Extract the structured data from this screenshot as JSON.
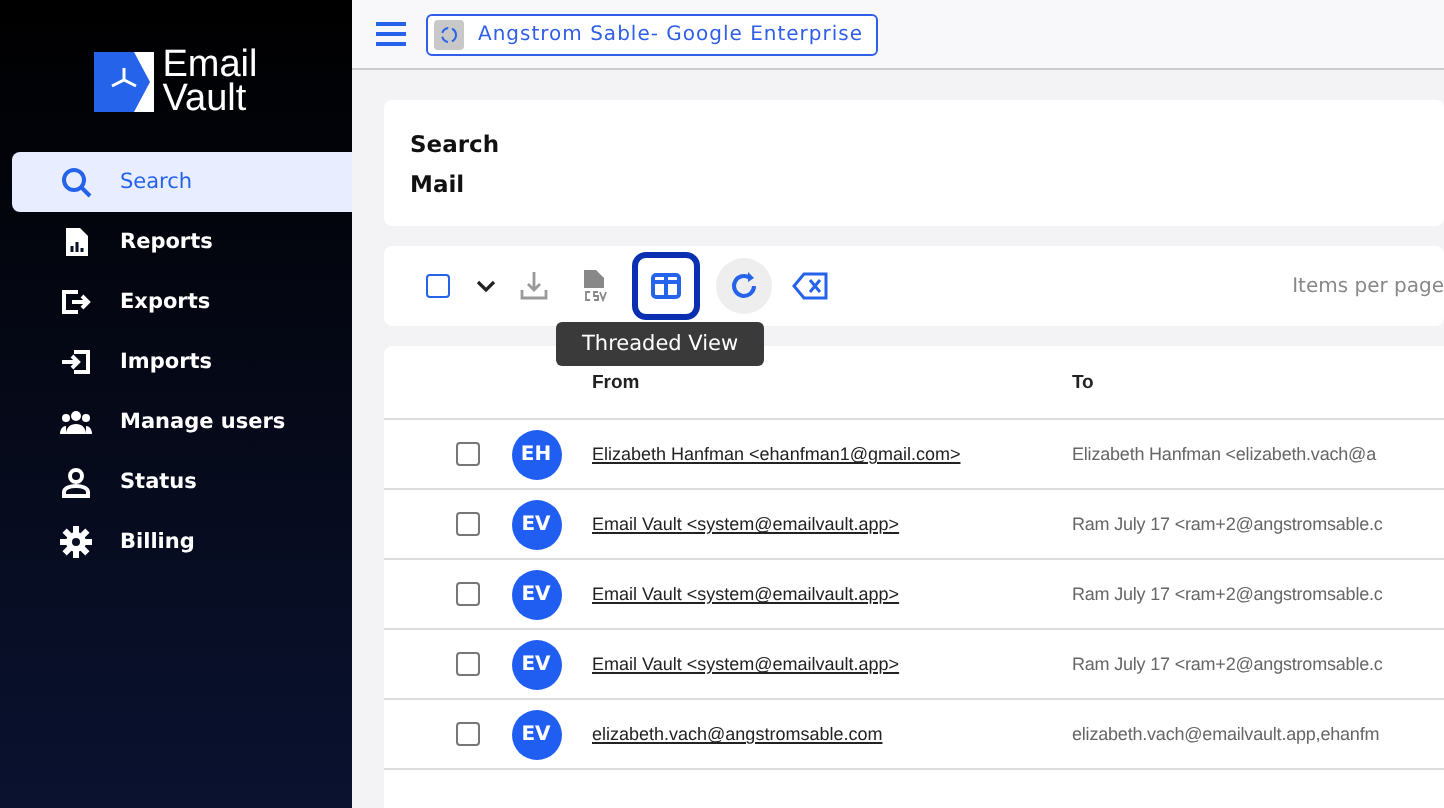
{
  "sidebar": {
    "logo": {
      "line1": "Email",
      "line2": "Vault"
    },
    "items": [
      {
        "label": "Search",
        "selected": true
      },
      {
        "label": "Reports",
        "selected": false
      },
      {
        "label": "Exports",
        "selected": false
      },
      {
        "label": "Imports",
        "selected": false
      },
      {
        "label": "Manage users",
        "selected": false
      },
      {
        "label": "Status",
        "selected": false
      },
      {
        "label": "Billing",
        "selected": false
      }
    ]
  },
  "header": {
    "account": "Angstrom Sable- Google Enterprise"
  },
  "search_card": {
    "title_line1": "Search",
    "title_line2": "Mail"
  },
  "toolbar": {
    "select_all_checked": false,
    "threaded_view_selected": true,
    "tooltip": "Threaded View",
    "items_per_page_label": "Items per page"
  },
  "table": {
    "columns": [
      "From",
      "To"
    ],
    "rows": [
      {
        "checked": false,
        "initials": "EH",
        "from": "Elizabeth Hanfman <ehanfman1@gmail.com>",
        "to": "Elizabeth Hanfman <elizabeth.vach@a"
      },
      {
        "checked": false,
        "initials": "EV",
        "from": "Email Vault <system@emailvault.app>",
        "to": "Ram July 17 <ram+2@angstromsable.c"
      },
      {
        "checked": false,
        "initials": "EV",
        "from": "Email Vault <system@emailvault.app>",
        "to": "Ram July 17 <ram+2@angstromsable.c"
      },
      {
        "checked": false,
        "initials": "EV",
        "from": "Email Vault <system@emailvault.app>",
        "to": "Ram July 17 <ram+2@angstromsable.c"
      },
      {
        "checked": false,
        "initials": "EV",
        "from": "elizabeth.vach@angstromsable.com",
        "to": "elizabeth.vach@emailvault.app,ehanfm"
      }
    ]
  }
}
